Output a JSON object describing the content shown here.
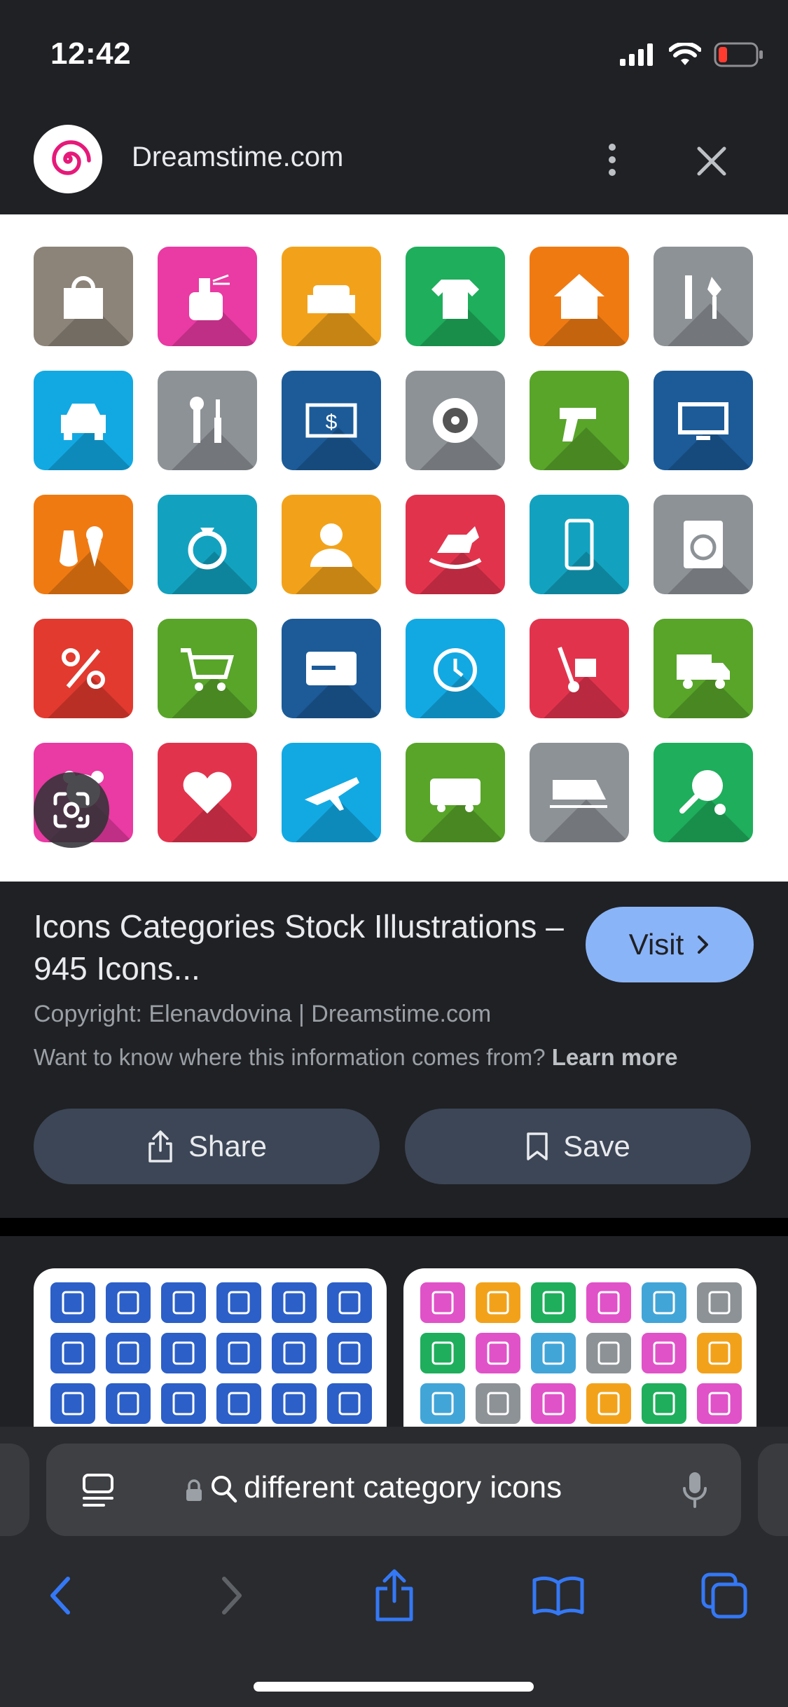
{
  "status_bar": {
    "time": "12:42",
    "battery_color": "#ff3b30"
  },
  "header": {
    "site_name": "Dreamstime.com",
    "logo_icon": "dreamstime-spiral-icon",
    "more_icon": "more-vert-icon",
    "close_icon": "close-icon"
  },
  "preview": {
    "tiles": [
      {
        "icon": "handbag-icon",
        "color": "#8c8479"
      },
      {
        "icon": "perfume-icon",
        "color": "#ea3aa3"
      },
      {
        "icon": "sofa-icon",
        "color": "#f2a21a"
      },
      {
        "icon": "tshirt-icon",
        "color": "#1fae5c"
      },
      {
        "icon": "house-icon",
        "color": "#f07a12"
      },
      {
        "icon": "garden-tools-icon",
        "color": "#8d9296"
      },
      {
        "icon": "car-icon",
        "color": "#12a9e3"
      },
      {
        "icon": "wrench-screwdriver-icon",
        "color": "#8d9296"
      },
      {
        "icon": "money-ticket-icon",
        "color": "#1c5b98"
      },
      {
        "icon": "tire-icon",
        "color": "#8d9296"
      },
      {
        "icon": "drill-icon",
        "color": "#58a52a"
      },
      {
        "icon": "tv-icon",
        "color": "#1c5b98"
      },
      {
        "icon": "food-icecream-icon",
        "color": "#f07a12"
      },
      {
        "icon": "ring-icon",
        "color": "#12a2bf"
      },
      {
        "icon": "person-icon",
        "color": "#f2a21a"
      },
      {
        "icon": "rocking-horse-icon",
        "color": "#e2334d"
      },
      {
        "icon": "smartphone-icon",
        "color": "#12a2bf"
      },
      {
        "icon": "washing-machine-icon",
        "color": "#8d9296"
      },
      {
        "icon": "percent-icon",
        "color": "#e23a2f"
      },
      {
        "icon": "shopping-cart-icon",
        "color": "#58a52a"
      },
      {
        "icon": "credit-card-icon",
        "color": "#1c5b98"
      },
      {
        "icon": "alarm-clock-icon",
        "color": "#12a9e3"
      },
      {
        "icon": "hand-truck-icon",
        "color": "#e2334d"
      },
      {
        "icon": "delivery-truck-icon",
        "color": "#58a52a"
      },
      {
        "icon": "teddy-bear-icon",
        "color": "#ea3aa3"
      },
      {
        "icon": "heart-icon",
        "color": "#e2334d"
      },
      {
        "icon": "airplane-icon",
        "color": "#12a9e3"
      },
      {
        "icon": "bus-icon",
        "color": "#58a52a"
      },
      {
        "icon": "train-icon",
        "color": "#8d9296"
      },
      {
        "icon": "ping-pong-icon",
        "color": "#1fae5c"
      }
    ],
    "lens_icon": "google-lens-icon"
  },
  "result": {
    "title": "Icons Categories Stock Illustrations – 945 Icons...",
    "visit_label": "Visit",
    "copyright": "Copyright: Elenavdovina | Dreamstime.com",
    "info_prompt": "Want to know where this information comes from?",
    "learn_more": "Learn more",
    "share_label": "Share",
    "save_label": "Save"
  },
  "more_results": {
    "blue": "#2c5fc7",
    "multicolor": [
      "#e052c8",
      "#f2a21a",
      "#1fae5c",
      "#e052c8",
      "#42a5d8",
      "#8d9296"
    ]
  },
  "address_bar": {
    "query": "different category icons",
    "tabs_overview_icon": "reader-icon",
    "lock_icon": "lock-icon",
    "search_icon": "search-icon",
    "mic_icon": "microphone-icon"
  },
  "toolbar": {
    "back_icon": "back-icon",
    "forward_icon": "forward-icon",
    "share_icon": "share-icon",
    "bookmarks_icon": "bookmarks-icon",
    "tabs_icon": "tabs-icon",
    "accent": "#3478f6"
  }
}
